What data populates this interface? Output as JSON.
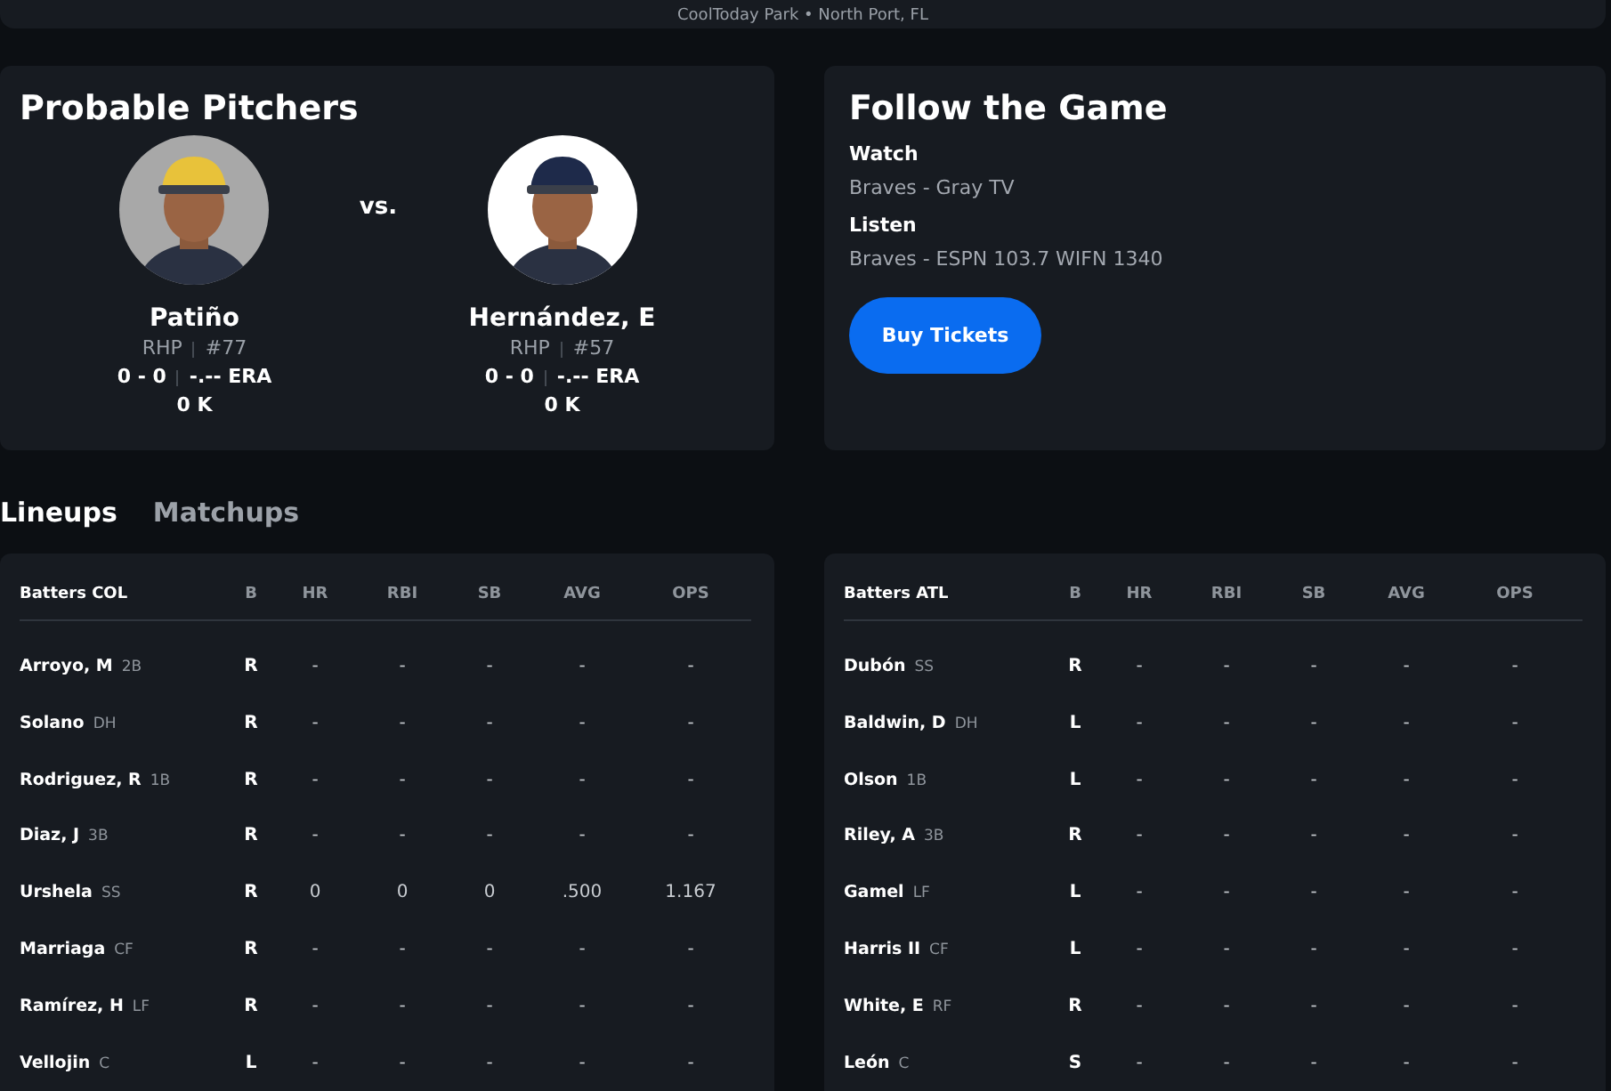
{
  "venue": "CoolToday Park • North Port, FL",
  "probable_pitchers": {
    "title": "Probable Pitchers",
    "versus": "vs.",
    "pitchers": [
      {
        "name": "Patiño",
        "throws": "RHP",
        "number": "#77",
        "record": "0 - 0",
        "era": "-.-- ERA",
        "strikeouts": "0 K"
      },
      {
        "name": "Hernández, E",
        "throws": "RHP",
        "number": "#57",
        "record": "0 - 0",
        "era": "-.-- ERA",
        "strikeouts": "0 K"
      }
    ]
  },
  "follow": {
    "title": "Follow the Game",
    "sections": [
      {
        "heading": "Watch",
        "text": "Braves - Gray TV"
      },
      {
        "heading": "Listen",
        "text": "Braves - ESPN 103.7 WIFN 1340"
      }
    ],
    "button": "Buy Tickets"
  },
  "tabs": [
    {
      "label": "Lineups",
      "selected": true
    },
    {
      "label": "Matchups",
      "selected": false
    }
  ],
  "lineups": [
    {
      "title": "Batters COL",
      "columns": [
        "B",
        "HR",
        "RBI",
        "SB",
        "AVG",
        "OPS"
      ],
      "rows": [
        {
          "name": "Arroyo, M",
          "pos": "2B",
          "cells": [
            "R",
            "-",
            "-",
            "-",
            "-",
            "-"
          ]
        },
        {
          "name": "Solano",
          "pos": "DH",
          "cells": [
            "R",
            "-",
            "-",
            "-",
            "-",
            "-"
          ]
        },
        {
          "name": "Rodriguez, R",
          "pos": "1B",
          "cells": [
            "R",
            "-",
            "-",
            "-",
            "-",
            "-"
          ]
        },
        {
          "name": "Diaz, J",
          "pos": "3B",
          "cells": [
            "R",
            "-",
            "-",
            "-",
            "-",
            "-"
          ]
        },
        {
          "name": "Urshela",
          "pos": "SS",
          "cells": [
            "R",
            "0",
            "0",
            "0",
            ".500",
            "1.167"
          ]
        },
        {
          "name": "Marriaga",
          "pos": "CF",
          "cells": [
            "R",
            "-",
            "-",
            "-",
            "-",
            "-"
          ]
        },
        {
          "name": "Ramírez, H",
          "pos": "LF",
          "cells": [
            "R",
            "-",
            "-",
            "-",
            "-",
            "-"
          ]
        },
        {
          "name": "Vellojin",
          "pos": "C",
          "cells": [
            "L",
            "-",
            "-",
            "-",
            "-",
            "-"
          ]
        }
      ]
    },
    {
      "title": "Batters ATL",
      "columns": [
        "B",
        "HR",
        "RBI",
        "SB",
        "AVG",
        "OPS"
      ],
      "rows": [
        {
          "name": "Dubón",
          "pos": "SS",
          "cells": [
            "R",
            "-",
            "-",
            "-",
            "-",
            "-"
          ]
        },
        {
          "name": "Baldwin, D",
          "pos": "DH",
          "cells": [
            "L",
            "-",
            "-",
            "-",
            "-",
            "-"
          ]
        },
        {
          "name": "Olson",
          "pos": "1B",
          "cells": [
            "L",
            "-",
            "-",
            "-",
            "-",
            "-"
          ]
        },
        {
          "name": "Riley, A",
          "pos": "3B",
          "cells": [
            "R",
            "-",
            "-",
            "-",
            "-",
            "-"
          ]
        },
        {
          "name": "Gamel",
          "pos": "LF",
          "cells": [
            "L",
            "-",
            "-",
            "-",
            "-",
            "-"
          ]
        },
        {
          "name": "Harris II",
          "pos": "CF",
          "cells": [
            "L",
            "-",
            "-",
            "-",
            "-",
            "-"
          ]
        },
        {
          "name": "White, E",
          "pos": "RF",
          "cells": [
            "R",
            "-",
            "-",
            "-",
            "-",
            "-"
          ]
        },
        {
          "name": "León",
          "pos": "C",
          "cells": [
            "S",
            "-",
            "-",
            "-",
            "-",
            "-"
          ]
        }
      ]
    }
  ]
}
